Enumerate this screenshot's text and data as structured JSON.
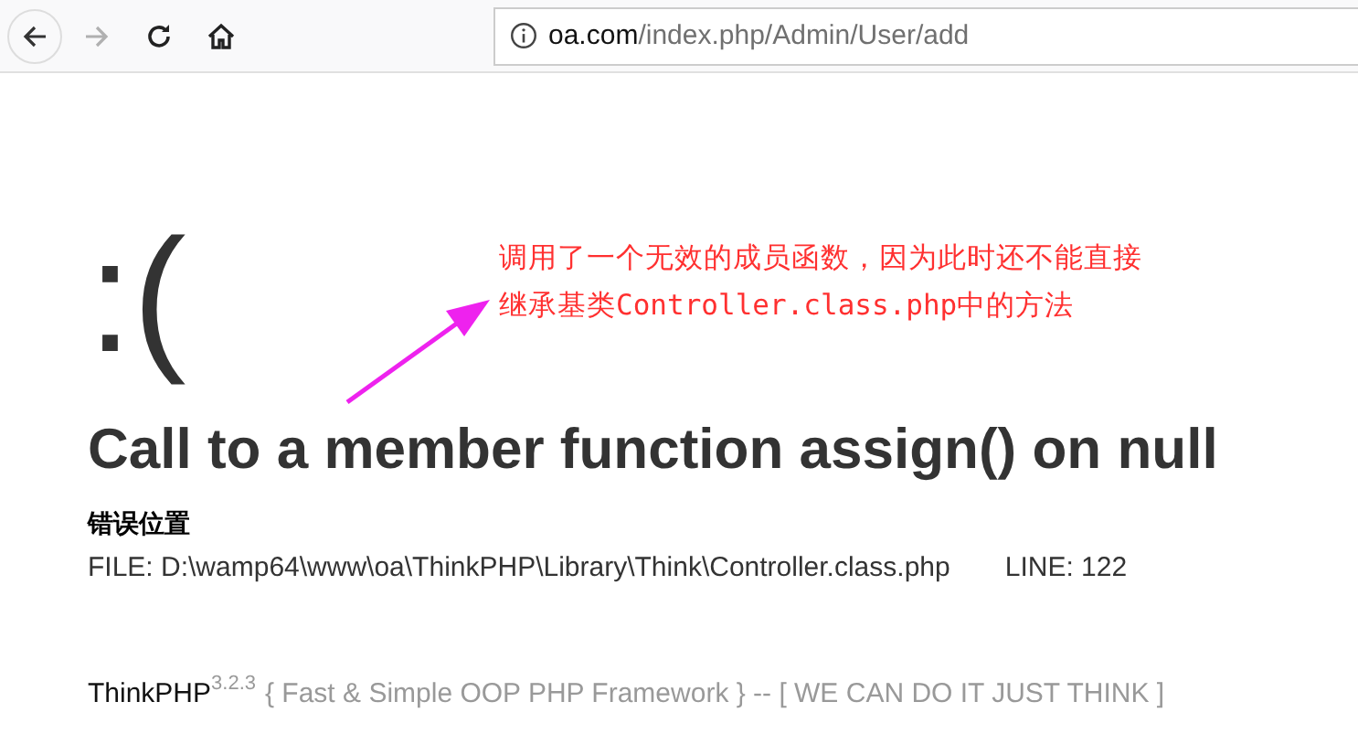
{
  "browser": {
    "address_host": "oa.com",
    "address_path": "/index.php/Admin/User/add",
    "back_disabled": false,
    "forward_disabled": true
  },
  "error": {
    "face": ":(",
    "message": "Call to a member function assign() on null",
    "location_heading": "错误位置",
    "file": "FILE: D:\\wamp64\\www\\oa\\ThinkPHP\\Library\\Think\\Controller.class.php",
    "line": "LINE: 122"
  },
  "annotation": {
    "lines": [
      "调用了一个无效的成员函数，因为此时还不能直接",
      "继承基类Controller.class.php中的方法"
    ]
  },
  "footer": {
    "brand": "ThinkPHP",
    "version": "3.2.3",
    "slogan": "{ Fast & Simple OOP PHP Framework } -- [ WE CAN DO IT JUST THINK ]"
  }
}
